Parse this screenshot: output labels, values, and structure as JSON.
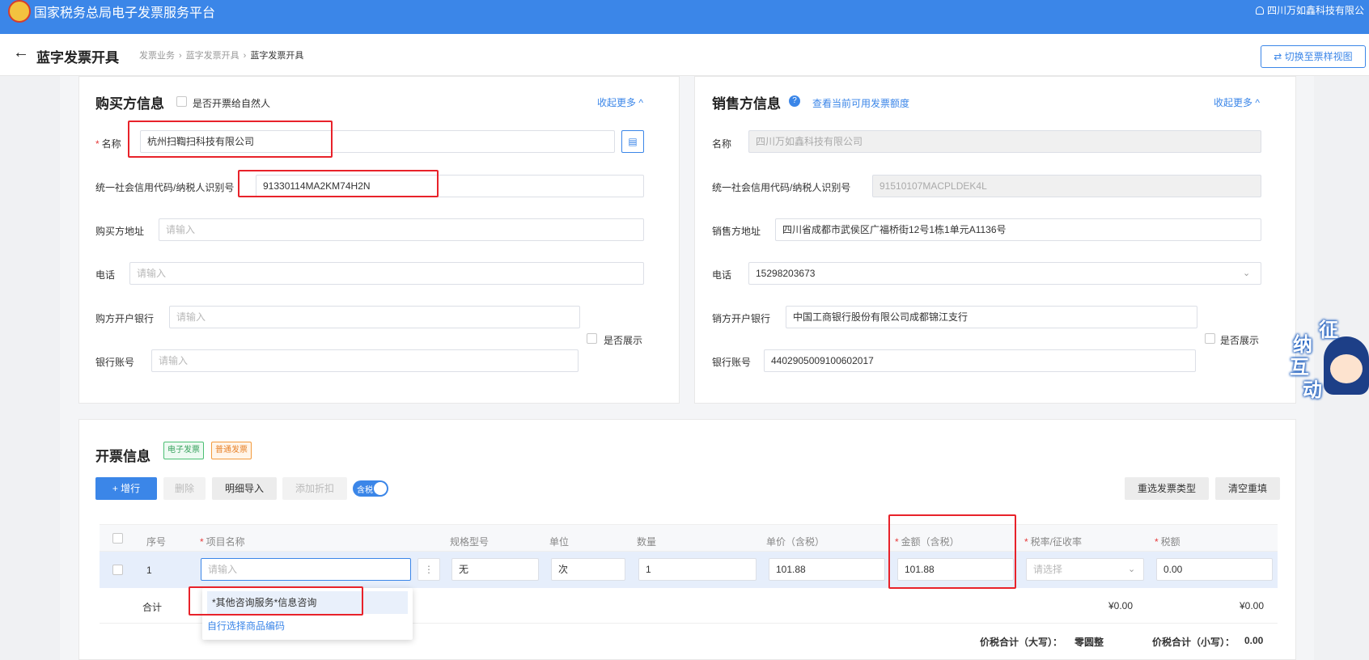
{
  "topbar": {
    "title": "国家税务总局电子发票服务平台",
    "user": "四川万如鑫科技有限公"
  },
  "subbar": {
    "back_icon": "←",
    "page_title": "蓝字发票开具",
    "breadcrumbs": [
      "发票业务",
      "蓝字发票开具",
      "蓝字发票开具"
    ],
    "switch_button": "⇄ 切换至票样视图"
  },
  "buyer": {
    "title": "购买方信息",
    "natural_person_label": "是否开票给自然人",
    "collapse": "收起更多 ^",
    "name_label": "名称",
    "name_value": "杭州扫鞫扫科技有限公司",
    "tax_id_label": "统一社会信用代码/纳税人识别号",
    "tax_id_value": "91330114MA2KM74H2N",
    "address_label": "购买方地址",
    "address_placeholder": "请输入",
    "phone_label": "电话",
    "phone_placeholder": "请输入",
    "bank_label": "购方开户银行",
    "bank_placeholder": "请输入",
    "show_label": "是否展示",
    "account_label": "银行账号",
    "account_placeholder": "请输入"
  },
  "seller": {
    "title": "销售方信息",
    "quota_link": "查看当前可用发票额度",
    "collapse": "收起更多 ^",
    "name_label": "名称",
    "name_value": "四川万如鑫科技有限公司",
    "tax_id_label": "统一社会信用代码/纳税人识别号",
    "tax_id_value": "91510107MACPLDEK4L",
    "address_label": "销售方地址",
    "address_value": "四川省成都市武侯区广福桥街12号1栋1单元A1136号",
    "phone_label": "电话",
    "phone_value": "15298203673",
    "bank_label": "销方开户银行",
    "bank_value": "中国工商银行股份有限公司成都锦江支行",
    "show_label": "是否展示",
    "account_label": "银行账号",
    "account_value": "4402905009100602017"
  },
  "invoice": {
    "title": "开票信息",
    "tag_electronic": "电子发票",
    "tag_normal": "普通发票",
    "add_row": "+ 增行",
    "delete": "删除",
    "import": "明细导入",
    "discount": "添加折扣",
    "tax_incl_toggle": "含税",
    "reselect": "重选发票类型",
    "clear": "清空重填",
    "columns": [
      "序号",
      "项目名称",
      "规格型号",
      "单位",
      "数量",
      "单价（含税）",
      "金额（含税）",
      "税率/征收率",
      "税额"
    ],
    "row": {
      "index": "1",
      "item_placeholder": "请输入",
      "spec": "无",
      "unit": "次",
      "qty": "1",
      "price": "101.88",
      "amount": "101.88",
      "rate_placeholder": "请选择",
      "tax": "0.00"
    },
    "total_label": "合计",
    "total_amount": "¥0.00",
    "total_tax": "¥0.00",
    "suggest_option": "*其他咨询服务*信息咨询",
    "suggest_link": "自行选择商品编码",
    "total_upper_label": "价税合计（大写）：",
    "total_upper_value": "零圆整",
    "total_lower_label": "价税合计（小写）：",
    "total_lower_value": "0.00"
  },
  "mascot": {
    "chars": [
      "征",
      "纳",
      "互",
      "动"
    ]
  }
}
